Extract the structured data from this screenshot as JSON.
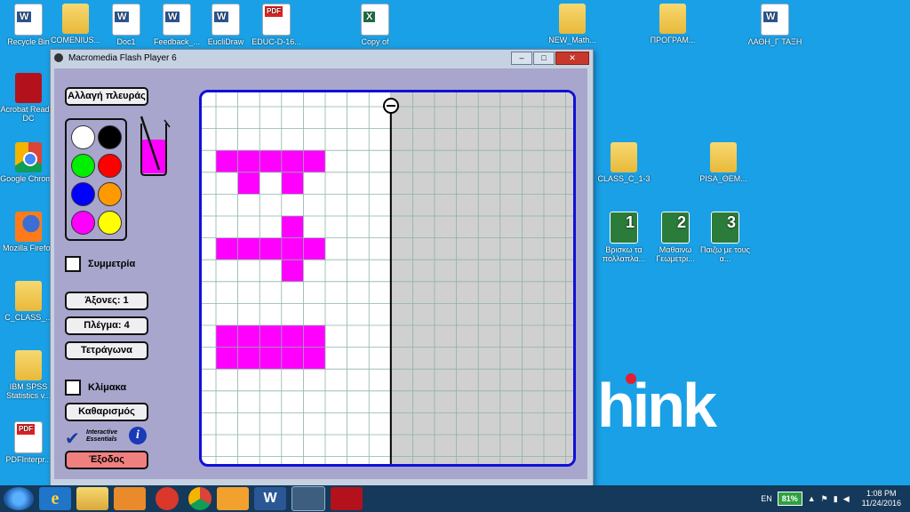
{
  "desktop_icons": [
    {
      "label": "Recycle Bin",
      "type": "recycle"
    },
    {
      "label": "COMENIUS...",
      "type": "folder"
    },
    {
      "label": "Doc1",
      "type": "doc"
    },
    {
      "label": "Feedback_...",
      "type": "doc"
    },
    {
      "label": "EucliDraw",
      "type": "app"
    },
    {
      "label": "EDUC-D-16...",
      "type": "pdf"
    },
    {
      "label": "Copy of",
      "type": "xls"
    },
    {
      "label": "NEW_Math...",
      "type": "folder"
    },
    {
      "label": "ΠΡΟΓΡΑΜ...",
      "type": "folder"
    },
    {
      "label": "ΛΑΘΗ_Γ ΤΑΞΗ",
      "type": "doc"
    },
    {
      "label": "Acrobat Reader DC",
      "type": "acrobat"
    },
    {
      "label": "Google Chrome",
      "type": "chrome"
    },
    {
      "label": "Mozilla Firefox",
      "type": "firefox"
    },
    {
      "label": "C_CLASS_...",
      "type": "folder"
    },
    {
      "label": "IBM SPSS Statistics v...",
      "type": "folder"
    },
    {
      "label": "PDFInterpr...",
      "type": "pdf"
    },
    {
      "label": "CLASS_C_1-3",
      "type": "folder"
    },
    {
      "label": "PISA_ΘΕΜ...",
      "type": "folder"
    },
    {
      "label": "Βρισκω τα πολλαπλα...",
      "type": "kid",
      "num": "1"
    },
    {
      "label": "Μαθαινω Γεωμετρι...",
      "type": "kid",
      "num": "2"
    },
    {
      "label": "Παιζω με τους α...",
      "type": "kid",
      "num": "3"
    }
  ],
  "wallpaper_text": "hink",
  "window": {
    "title": "Macromedia Flash Player 6",
    "buttons": [
      "–",
      "□",
      "✕"
    ]
  },
  "app": {
    "change_side": "Αλλαγή πλευράς",
    "symmetry": "Συμμετρία",
    "axes": "Άξονες: 1",
    "grid": "Πλέγμα: 4",
    "squares": "Τετράγωνα",
    "scale": "Κλίμακα",
    "clear": "Καθαρισμός",
    "exit": "Έξοδος",
    "brand": "Interactive Essentials",
    "info": "i",
    "current_color": "#ff00ff",
    "colors": [
      "#ffffff",
      "#000000",
      "#00ee00",
      "#ff0000",
      "#0000ff",
      "#ff9900",
      "#ff00ff",
      "#ffff00"
    ],
    "grid_cols": 17,
    "grid_rows": 17,
    "mirror_axis_col": 8,
    "filled_cells": [
      [
        1,
        3
      ],
      [
        2,
        3
      ],
      [
        3,
        3
      ],
      [
        4,
        3
      ],
      [
        5,
        3
      ],
      [
        2,
        4
      ],
      [
        4,
        4
      ],
      [
        4,
        6
      ],
      [
        1,
        7
      ],
      [
        2,
        7
      ],
      [
        3,
        7
      ],
      [
        4,
        7
      ],
      [
        5,
        7
      ],
      [
        4,
        8
      ],
      [
        1,
        11
      ],
      [
        2,
        11
      ],
      [
        3,
        11
      ],
      [
        4,
        11
      ],
      [
        5,
        11
      ],
      [
        1,
        12
      ],
      [
        2,
        12
      ],
      [
        3,
        12
      ],
      [
        4,
        12
      ],
      [
        5,
        12
      ]
    ]
  },
  "taskbar": {
    "lang": "EN",
    "battery": "81%",
    "time": "1:08 PM",
    "date": "11/24/2016"
  }
}
